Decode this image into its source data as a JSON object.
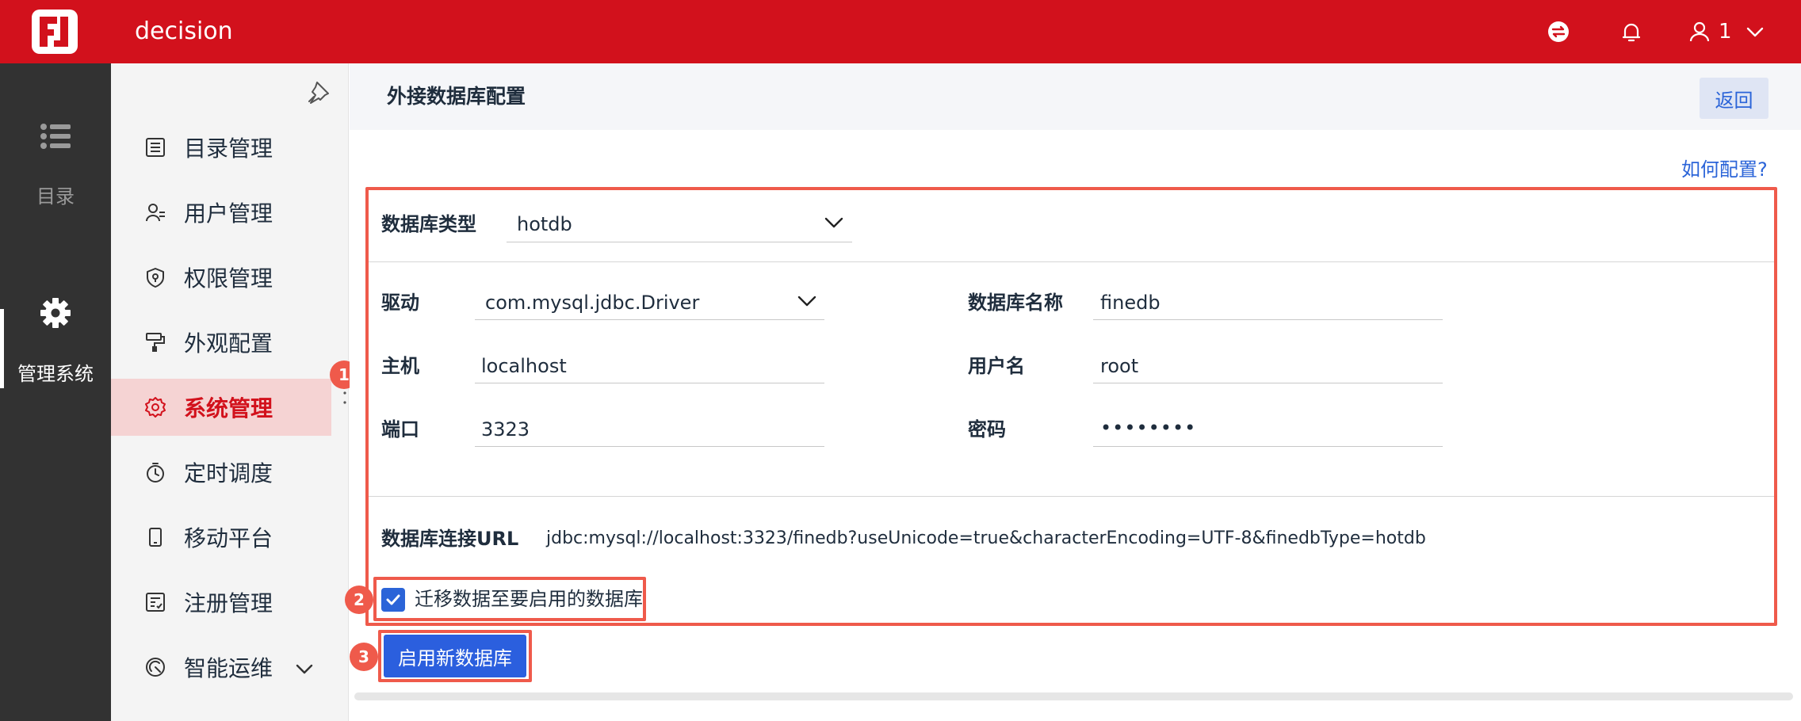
{
  "header": {
    "app_title": "decision",
    "user_name": "1"
  },
  "rail": {
    "items": [
      {
        "label": "目录"
      },
      {
        "label": "管理系统"
      }
    ]
  },
  "subnav": {
    "items": [
      {
        "label": "目录管理"
      },
      {
        "label": "用户管理"
      },
      {
        "label": "权限管理"
      },
      {
        "label": "外观配置"
      },
      {
        "label": "系统管理"
      },
      {
        "label": "定时调度"
      },
      {
        "label": "移动平台"
      },
      {
        "label": "注册管理"
      },
      {
        "label": "智能运维"
      }
    ]
  },
  "page": {
    "title": "外接数据库配置",
    "back_label": "返回",
    "help_link": "如何配置?"
  },
  "form": {
    "db_type_label": "数据库类型",
    "db_type_value": "hotdb",
    "driver_label": "驱动",
    "driver_value": "com.mysql.jdbc.Driver",
    "db_name_label": "数据库名称",
    "db_name_value": "finedb",
    "host_label": "主机",
    "host_value": "localhost",
    "username_label": "用户名",
    "username_value": "root",
    "port_label": "端口",
    "port_value": "3323",
    "password_label": "密码",
    "password_value": "••••••••",
    "url_label": "数据库连接URL",
    "url_value": "jdbc:mysql://localhost:3323/finedb?useUnicode=true&characterEncoding=UTF-8&finedbType=hotdb"
  },
  "migrate": {
    "label": "迁移数据至要启用的数据库",
    "checked": true
  },
  "enable_button": "启用新数据库",
  "badges": [
    "1",
    "2",
    "3"
  ],
  "colors": {
    "brand": "#d2111c",
    "primary": "#2b5fde",
    "highlight": "#ef5a4b",
    "rail": "#323232"
  }
}
